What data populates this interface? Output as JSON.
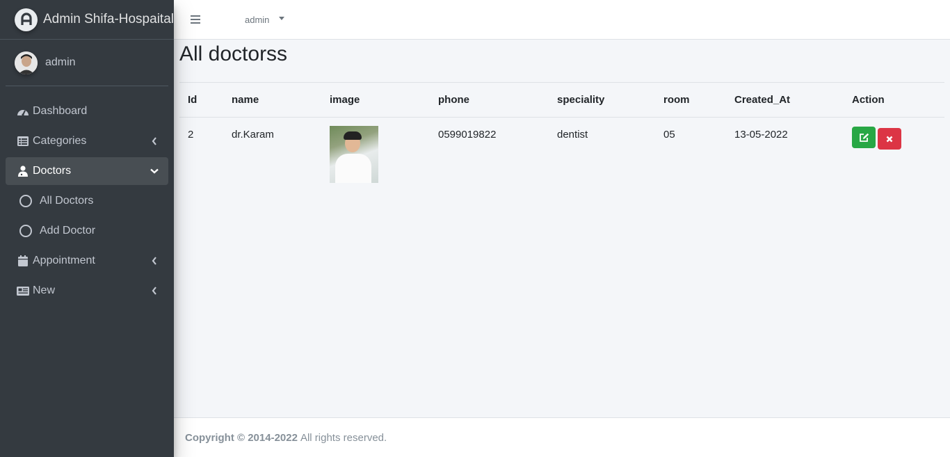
{
  "brand": {
    "title": "Admin Shifa-Hospaital"
  },
  "user": {
    "name": "admin"
  },
  "sidebar": {
    "items": [
      {
        "label": "Dashboard",
        "icon": "dashboard-icon"
      },
      {
        "label": "Categories",
        "icon": "list-icon"
      },
      {
        "label": "Doctors",
        "icon": "doctor-icon"
      },
      {
        "label": "Appointment",
        "icon": "calendar-icon"
      },
      {
        "label": "New",
        "icon": "newspaper-icon"
      }
    ],
    "doctors_sub": [
      {
        "label": "All Doctors"
      },
      {
        "label": "Add Doctor"
      }
    ]
  },
  "header": {
    "user_label": "admin"
  },
  "page": {
    "title": "All doctorss"
  },
  "table": {
    "columns": [
      "Id",
      "name",
      "image",
      "phone",
      "speciality",
      "room",
      "Created_At",
      "Action"
    ],
    "rows": [
      {
        "id": "2",
        "name": "dr.Karam",
        "phone": "0599019822",
        "speciality": "dentist",
        "room": "05",
        "created_at": "13-05-2022"
      }
    ]
  },
  "footer": {
    "copyright": "Copyright © 2014-2022",
    "rights": "All rights reserved."
  },
  "colors": {
    "sidebar": "#343a40",
    "edit": "#28a745",
    "delete": "#dc3545"
  }
}
